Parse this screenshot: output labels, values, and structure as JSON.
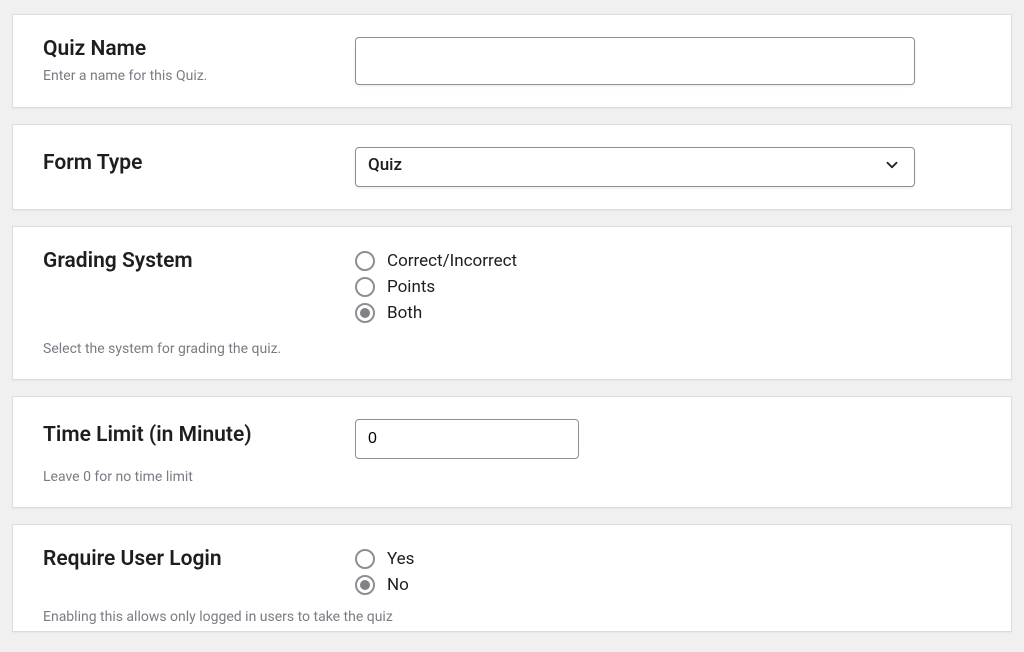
{
  "quiz_name": {
    "label": "Quiz Name",
    "help": "Enter a name for this Quiz.",
    "value": ""
  },
  "form_type": {
    "label": "Form Type",
    "selected": "Quiz"
  },
  "grading_system": {
    "label": "Grading System",
    "help": "Select the system for grading the quiz.",
    "options": {
      "correct_incorrect": "Correct/Incorrect",
      "points": "Points",
      "both": "Both"
    },
    "selected": "both"
  },
  "time_limit": {
    "label": "Time Limit (in Minute)",
    "help": "Leave 0 for no time limit",
    "value": "0"
  },
  "require_login": {
    "label": "Require User Login",
    "help": "Enabling this allows only logged in users to take the quiz",
    "options": {
      "yes": "Yes",
      "no": "No"
    },
    "selected": "no"
  }
}
